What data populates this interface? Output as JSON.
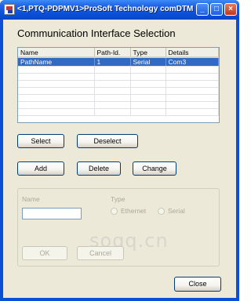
{
  "window": {
    "title": "<1,PTQ-PDPMV1>ProSoft Technology comDTM ...",
    "controls": {
      "minimize": "_",
      "maximize": "□",
      "close": "×"
    }
  },
  "heading": "Communication Interface Selection",
  "list": {
    "columns": [
      "Name",
      "Path-Id.",
      "Type",
      "Details"
    ],
    "rows": [
      {
        "name": "PathName",
        "path_id": "1",
        "type": "Serial",
        "details": "Com3",
        "selected": true
      }
    ]
  },
  "buttons": {
    "select": "Select",
    "deselect": "Deselect",
    "add": "Add",
    "delete": "Delete",
    "change": "Change",
    "ok": "OK",
    "cancel": "Cancel",
    "close": "Close"
  },
  "editor": {
    "name_label": "Name",
    "name_value": "",
    "type_label": "Type",
    "type_options": [
      "Ethernet",
      "Serial"
    ]
  },
  "watermark": "soqq.cn",
  "icons": {
    "app": "prosoft-app-icon",
    "minimize": "minimize-icon",
    "maximize": "maximize-icon",
    "close": "close-icon"
  }
}
